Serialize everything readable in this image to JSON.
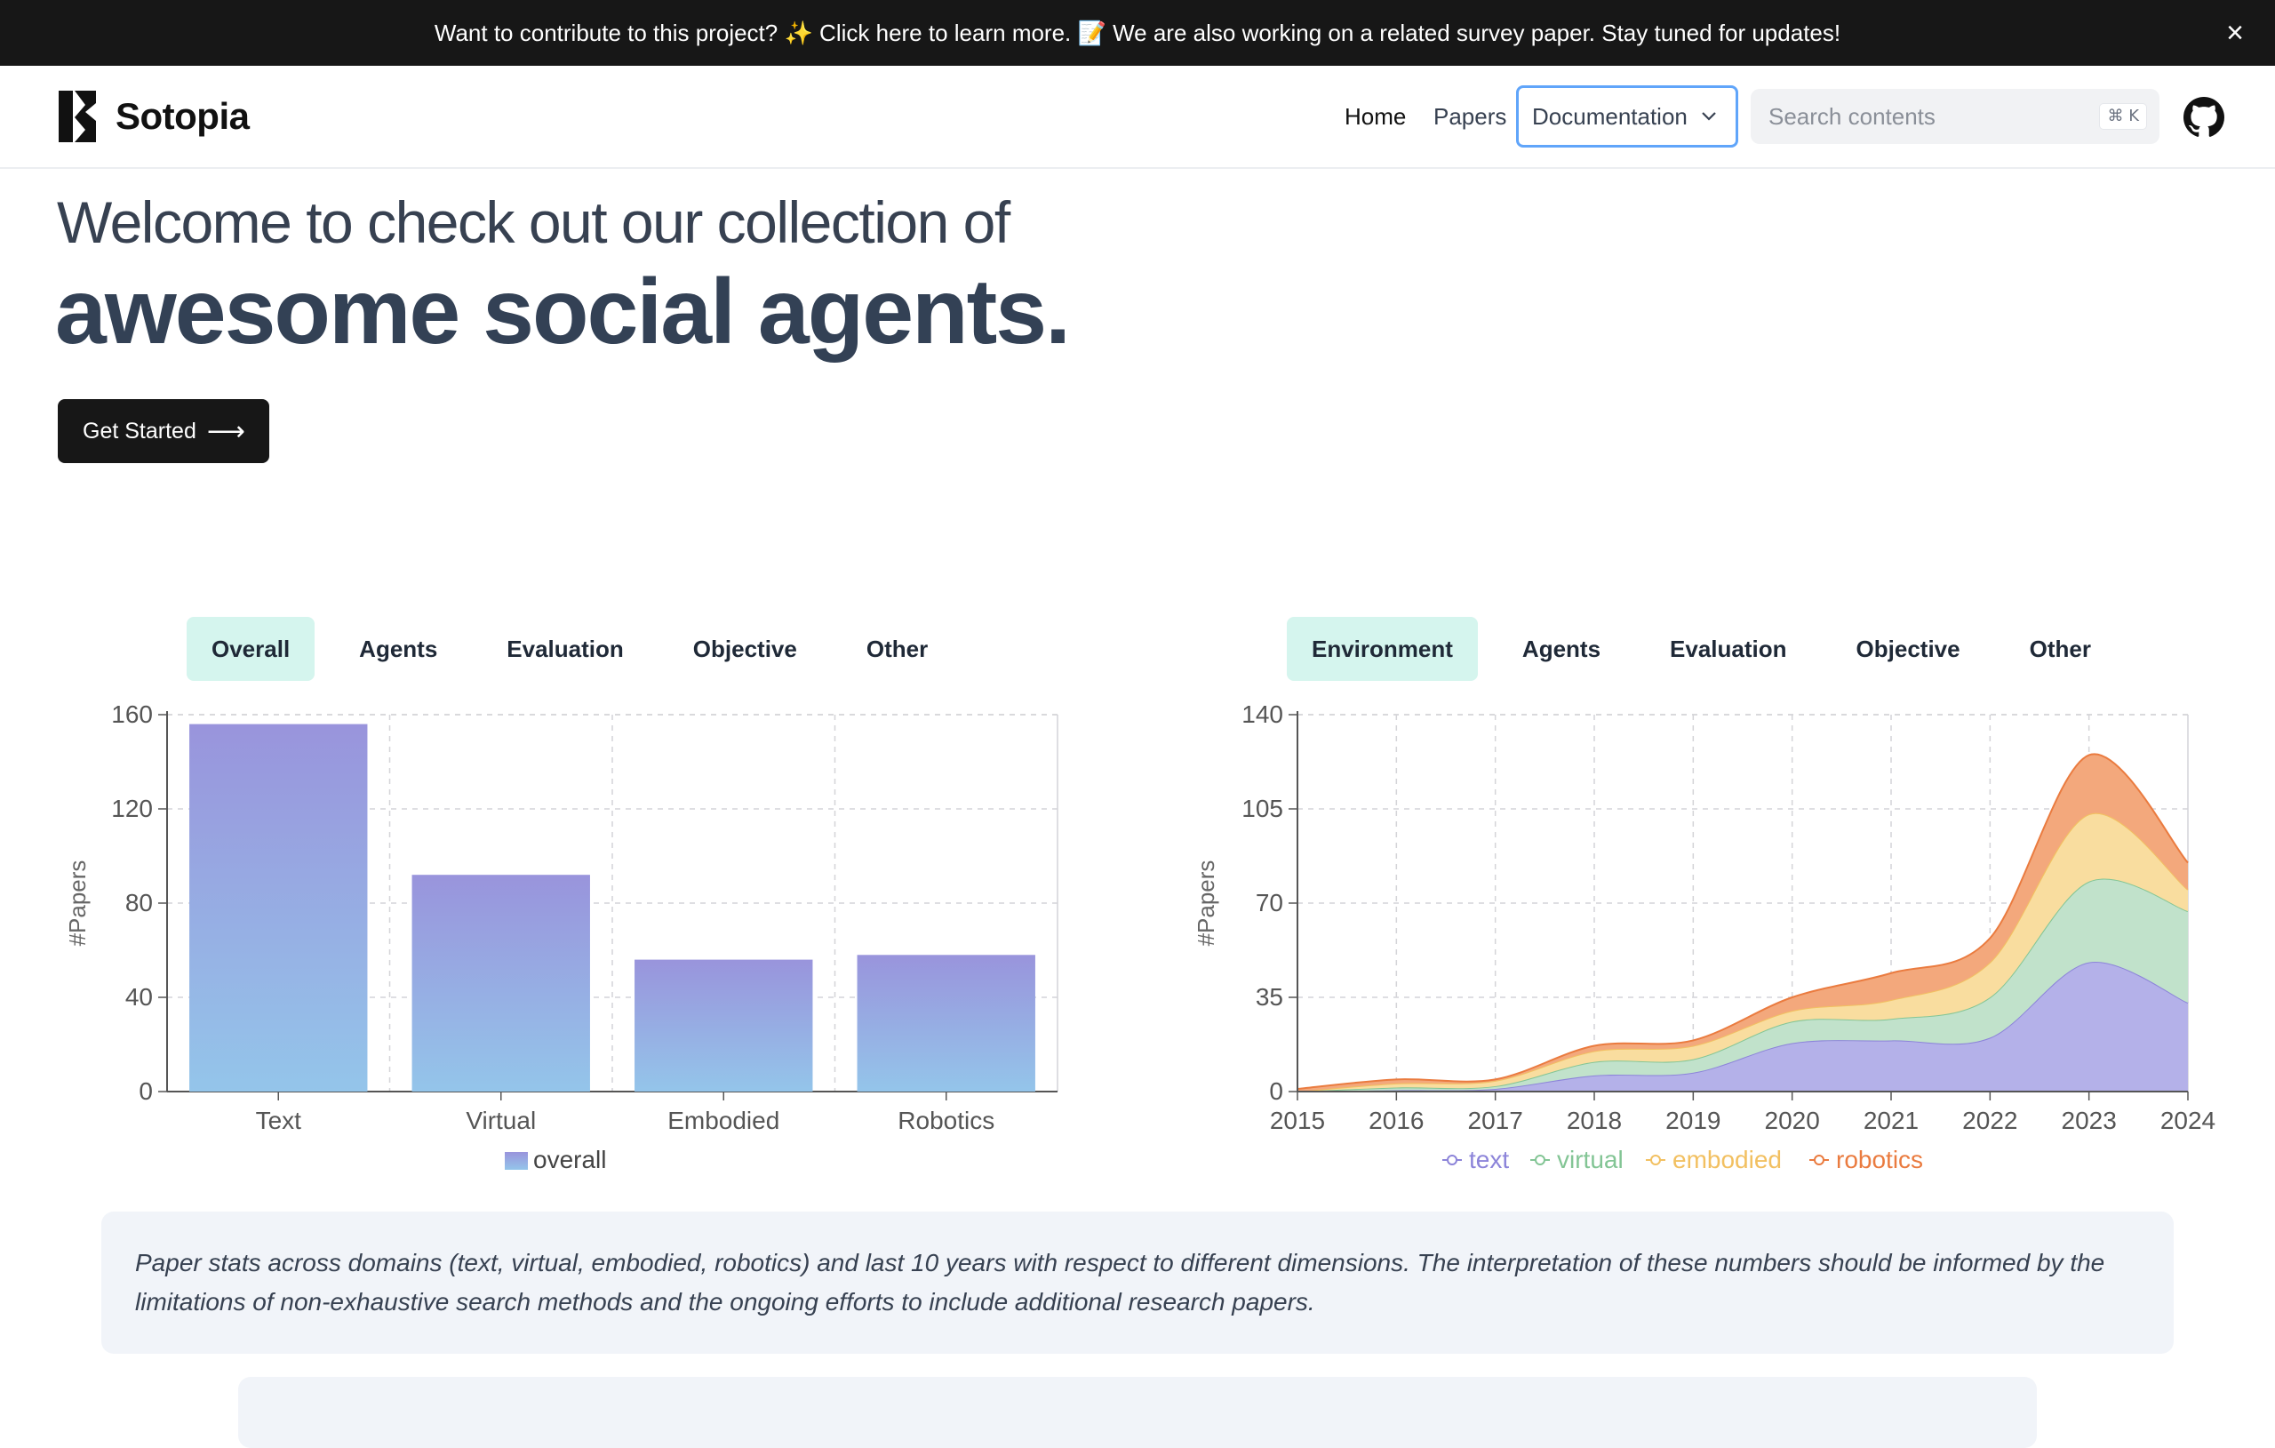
{
  "banner": {
    "text": "Want to contribute to this project? ✨ Click here to learn more. 📝 We are also working on a related survey paper. Stay tuned for updates!",
    "close_icon": "×"
  },
  "nav": {
    "brand": "Sotopia",
    "links": [
      "Home",
      "Papers"
    ],
    "documentation": "Documentation",
    "search_placeholder": "Search contents",
    "search_shortcut": "⌘ K"
  },
  "hero": {
    "subtitle": "Welcome to check out our collection of",
    "title": "awesome social agents.",
    "cta": "Get Started",
    "cta_arrow": "⟶"
  },
  "left_tabs": [
    {
      "label": "Overall",
      "active": true
    },
    {
      "label": "Agents",
      "active": false
    },
    {
      "label": "Evaluation",
      "active": false
    },
    {
      "label": "Objective",
      "active": false
    },
    {
      "label": "Other",
      "active": false
    }
  ],
  "right_tabs": [
    {
      "label": "Environment",
      "active": true
    },
    {
      "label": "Agents",
      "active": false
    },
    {
      "label": "Evaluation",
      "active": false
    },
    {
      "label": "Objective",
      "active": false
    },
    {
      "label": "Other",
      "active": false
    }
  ],
  "chart_data": [
    {
      "type": "bar",
      "categories": [
        "Text",
        "Virtual",
        "Embodied",
        "Robotics"
      ],
      "series": [
        {
          "name": "overall",
          "values": [
            156,
            92,
            56,
            58
          ]
        }
      ],
      "ylabel": "#Papers",
      "ylim": [
        0,
        160
      ],
      "yticks": [
        0,
        40,
        80,
        120,
        160
      ],
      "grid": true,
      "legend": "bottom",
      "colors": {
        "top": "#9994dc",
        "bottom": "#94c5ea"
      }
    },
    {
      "type": "area",
      "stacked": true,
      "x": [
        2015,
        2016,
        2017,
        2018,
        2019,
        2020,
        2021,
        2022,
        2023,
        2024
      ],
      "series": [
        {
          "name": "text",
          "values": [
            0,
            0.5,
            1,
            6,
            7,
            18,
            19,
            20,
            48,
            33
          ],
          "color": "#8c84d9",
          "fill": "#b4b1e9"
        },
        {
          "name": "virtual",
          "values": [
            0,
            1,
            1,
            5,
            5,
            8,
            8,
            15,
            30,
            34
          ],
          "color": "#83c595",
          "fill": "#c1e2cb"
        },
        {
          "name": "embodied",
          "values": [
            0,
            1.5,
            2,
            4,
            5,
            4,
            7,
            13,
            25,
            8
          ],
          "color": "#f2c061",
          "fill": "#f9dd9f"
        },
        {
          "name": "robotics",
          "values": [
            1,
            1.5,
            0.5,
            2,
            2,
            5,
            10,
            9,
            22,
            10
          ],
          "color": "#ea7b3f",
          "fill": "#f3a87c"
        }
      ],
      "ylabel": "#Papers",
      "ylim": [
        0,
        140
      ],
      "yticks": [
        0,
        35,
        70,
        105,
        140
      ],
      "grid": true,
      "legend": "bottom"
    }
  ],
  "caption": "Paper stats across domains (text, virtual, embodied, robotics) and last 10 years with respect to different dimensions. The interpretation of these numbers should be informed by the limitations of non-exhaustive search methods and the ongoing efforts to include additional research papers."
}
